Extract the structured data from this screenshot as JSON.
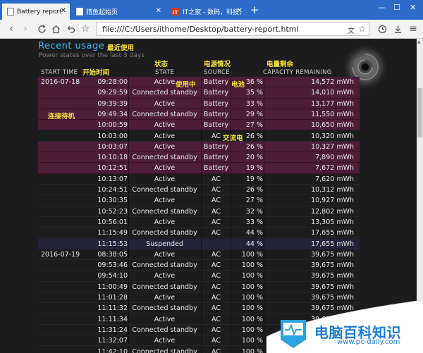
{
  "browser": {
    "tabs": [
      {
        "title": "Battery report"
      },
      {
        "title": "猎鱼起始页"
      },
      {
        "title": "IT之家 - 数码，科技，生"
      }
    ],
    "url": "file:///C:/Users/ithome/Desktop/battery-report.html"
  },
  "report": {
    "section_title": "Recent usage",
    "section_subtitle": "Power states over the last 3 days",
    "headers": {
      "start_time": "START TIME",
      "state": "STATE",
      "source": "SOURCE",
      "capacity": "CAPACITY REMAINING"
    },
    "rows": [
      {
        "date": "2016-07-18",
        "time": "09:28:00",
        "state": "Active",
        "source": "Battery",
        "percent": "36 %",
        "capacity": "14,572 mWh"
      },
      {
        "date": "",
        "time": "09:29:59",
        "state": "Connected standby",
        "source": "Battery",
        "percent": "35 %",
        "capacity": "14,010 mWh"
      },
      {
        "date": "",
        "time": "09:39:39",
        "state": "Active",
        "source": "Battery",
        "percent": "33 %",
        "capacity": "13,177 mWh"
      },
      {
        "date": "",
        "time": "09:49:34",
        "state": "Connected standby",
        "source": "Battery",
        "percent": "29 %",
        "capacity": "11,550 mWh"
      },
      {
        "date": "",
        "time": "10:00:59",
        "state": "Active",
        "source": "Battery",
        "percent": "27 %",
        "capacity": "10,650 mWh"
      },
      {
        "date": "",
        "time": "10:03:00",
        "state": "Active",
        "source": "AC",
        "percent": "26 %",
        "capacity": "10,320 mWh"
      },
      {
        "date": "",
        "time": "10:03:07",
        "state": "Active",
        "source": "Battery",
        "percent": "26 %",
        "capacity": "10,327 mWh"
      },
      {
        "date": "",
        "time": "10:10:18",
        "state": "Connected standby",
        "source": "Battery",
        "percent": "20 %",
        "capacity": "7,890 mWh"
      },
      {
        "date": "",
        "time": "10:12:51",
        "state": "Active",
        "source": "Battery",
        "percent": "19 %",
        "capacity": "7,672 mWh"
      },
      {
        "date": "",
        "time": "10:13:07",
        "state": "Active",
        "source": "AC",
        "percent": "19 %",
        "capacity": "7,620 mWh"
      },
      {
        "date": "",
        "time": "10:24:51",
        "state": "Connected standby",
        "source": "AC",
        "percent": "26 %",
        "capacity": "10,312 mWh"
      },
      {
        "date": "",
        "time": "10:30:35",
        "state": "Active",
        "source": "AC",
        "percent": "27 %",
        "capacity": "10,927 mWh"
      },
      {
        "date": "",
        "time": "10:52:23",
        "state": "Connected standby",
        "source": "AC",
        "percent": "32 %",
        "capacity": "12,802 mWh"
      },
      {
        "date": "",
        "time": "10:56:01",
        "state": "Active",
        "source": "AC",
        "percent": "33 %",
        "capacity": "13,305 mWh"
      },
      {
        "date": "",
        "time": "11:15:49",
        "state": "Connected standby",
        "source": "AC",
        "percent": "44 %",
        "capacity": "17,655 mWh"
      },
      {
        "date": "",
        "time": "11:15:53",
        "state": "Suspended",
        "source": "",
        "percent": "44 %",
        "capacity": "17,655 mWh"
      },
      {
        "date": "2016-07-19",
        "time": "08:38:05",
        "state": "Active",
        "source": "AC",
        "percent": "100 %",
        "capacity": "39,675 mWh"
      },
      {
        "date": "",
        "time": "09:53:46",
        "state": "Connected standby",
        "source": "AC",
        "percent": "100 %",
        "capacity": "39,675 mWh"
      },
      {
        "date": "",
        "time": "09:54:10",
        "state": "Active",
        "source": "AC",
        "percent": "100 %",
        "capacity": "39,675 mWh"
      },
      {
        "date": "",
        "time": "11:00:49",
        "state": "Connected standby",
        "source": "AC",
        "percent": "100 %",
        "capacity": "39,675 mWh"
      },
      {
        "date": "",
        "time": "11:01:28",
        "state": "Active",
        "source": "AC",
        "percent": "100 %",
        "capacity": "39,675 mWh"
      },
      {
        "date": "",
        "time": "11:11:32",
        "state": "Connected standby",
        "source": "AC",
        "percent": "100 %",
        "capacity": "39,675 mWh"
      },
      {
        "date": "",
        "time": "11:11:34",
        "state": "Active",
        "source": "AC",
        "percent": "100 %",
        "capacity": "39,675 mWh"
      },
      {
        "date": "",
        "time": "11:31:24",
        "state": "Connected standby",
        "source": "AC",
        "percent": "100 %",
        "capacity": "39,675 mWh"
      },
      {
        "date": "",
        "time": "11:32:07",
        "state": "Active",
        "source": "AC",
        "percent": "100 %",
        "capacity": "39,675 mWh"
      },
      {
        "date": "",
        "time": "11:42:10",
        "state": "Connected standby",
        "source": "AC",
        "percent": "100 %",
        "capacity": "39,675 mWh"
      }
    ]
  },
  "annotations": {
    "recent_usage": "最近使用",
    "start_time": "开始时间",
    "state": "状态",
    "source": "电源情况",
    "capacity": "电量剩余",
    "in_use": "使用中",
    "battery": "电池",
    "standby": "连接待机",
    "ac": "交流电"
  },
  "watermark": {
    "title": "电脑百科知识",
    "url": "www.pc-daily.com"
  },
  "colors": {
    "accent_blue": "#3ab4ea",
    "battery_row": "#4d1d3a",
    "annotation_yellow": "#f6e03c",
    "tab_bar": "#2c6bc9",
    "watermark_blue": "#1c7bd6"
  }
}
